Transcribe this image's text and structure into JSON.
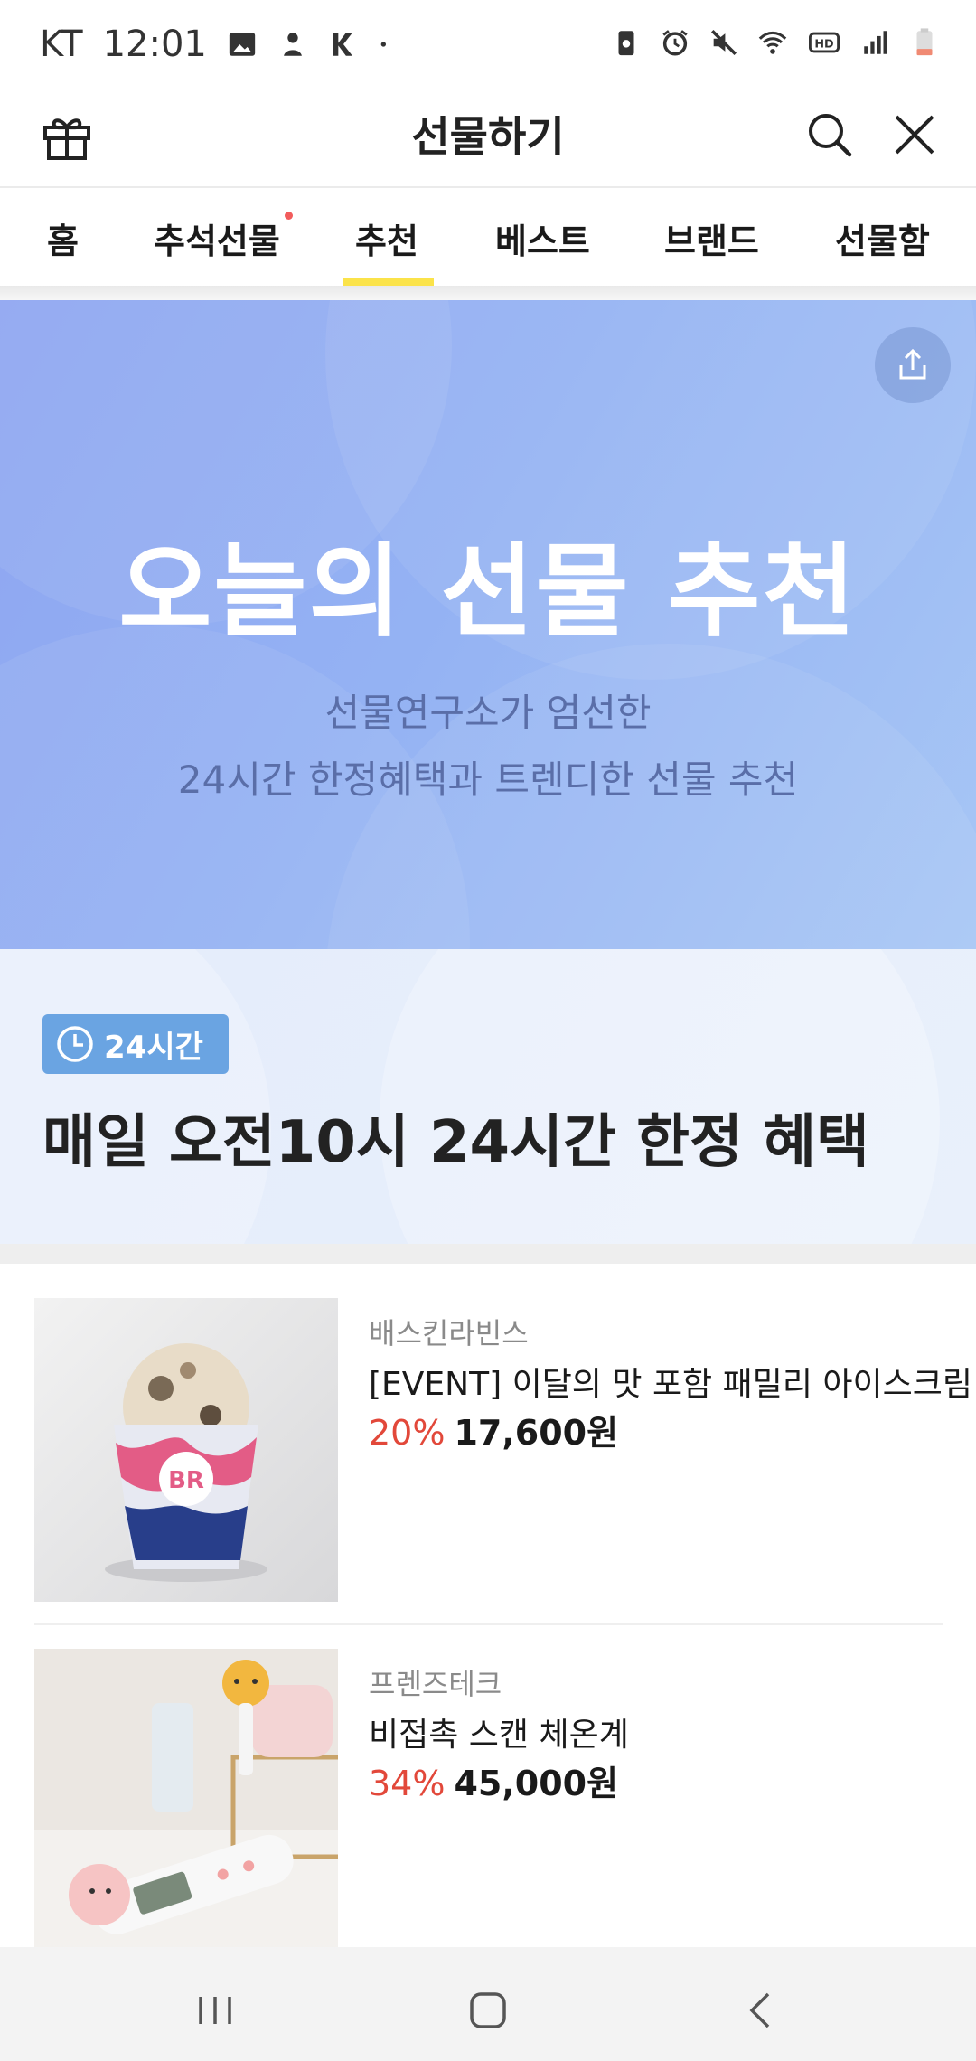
{
  "status_bar": {
    "carrier": "KT",
    "time": "12:01"
  },
  "header": {
    "title": "선물하기"
  },
  "tabs": [
    {
      "label": "홈",
      "has_dot": false
    },
    {
      "label": "추석선물",
      "has_dot": true
    },
    {
      "label": "추천",
      "active": true
    },
    {
      "label": "베스트"
    },
    {
      "label": "브랜드"
    },
    {
      "label": "선물함"
    }
  ],
  "banner": {
    "heading": "오늘의 선물 추천",
    "sub_line1": "선물연구소가 엄선한",
    "sub_line2": "24시간 한정혜택과 트렌디한 선물 추천"
  },
  "section": {
    "badge": "24시간",
    "title": "매일 오전10시 24시간 한정 혜택"
  },
  "products": [
    {
      "brand": "배스킨라빈스",
      "name": "[EVENT] 이달의 맛 포함 패밀리 아이스크림",
      "discount": "20%",
      "price": "17,600원"
    },
    {
      "brand": "프렌즈테크",
      "name": "비접촉 스캔 체온계",
      "discount": "34%",
      "price": "45,000원"
    }
  ],
  "colors": {
    "accent_tab": "#fbe34a",
    "discount": "#e2483a",
    "badge": "#6aa4e2"
  },
  "icons": [
    "gift-icon",
    "search-icon",
    "close-icon",
    "share-icon",
    "clock-icon",
    "recents-icon",
    "home-icon",
    "back-icon"
  ]
}
